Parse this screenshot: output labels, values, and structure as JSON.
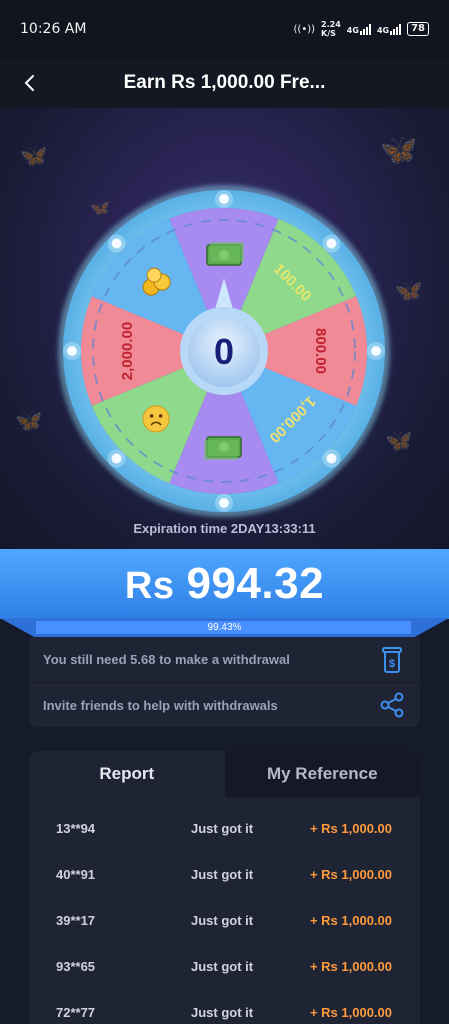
{
  "status": {
    "time": "10:26 AM",
    "net_speed": "2.24",
    "net_unit": "K/S",
    "signal1": "4G",
    "signal2": "4G",
    "battery": "78"
  },
  "header": {
    "back_icon": "chevron-left-icon",
    "title": "Earn Rs 1,000.00 Fre..."
  },
  "wheel": {
    "center_value": "0",
    "segments": [
      {
        "label": "cash-icon",
        "color": "#a78bf0"
      },
      {
        "label": "100.00",
        "color": "#8fd98c"
      },
      {
        "label": "800.00",
        "color": "#f08a97"
      },
      {
        "label": "1,000.00",
        "color": "#66b6f2"
      },
      {
        "label": "cash-icon",
        "color": "#a78bf0"
      },
      {
        "label": "sad-face-icon",
        "color": "#8fd98c"
      },
      {
        "label": "2,000.00",
        "color": "#f08a97"
      },
      {
        "label": "coins-icon",
        "color": "#66b6f2"
      }
    ],
    "expiration": "Expiration time  2DAY13:33:11"
  },
  "balance": {
    "currency": "Rs",
    "amount": "994.32",
    "progress_text": "99.43%",
    "progress": 0.9943
  },
  "info": {
    "withdraw_note": "You still need 5.68 to make a withdrawal",
    "withdraw_icon": "withdraw-icon",
    "invite_note": "Invite friends to help with withdrawals",
    "share_icon": "share-icon"
  },
  "tabs": {
    "report": "Report",
    "reference": "My Reference"
  },
  "report_rows": [
    {
      "user": "13**94",
      "msg": "Just got it",
      "amount": "+ Rs 1,000.00"
    },
    {
      "user": "40**91",
      "msg": "Just got it",
      "amount": "+ Rs 1,000.00"
    },
    {
      "user": "39**17",
      "msg": "Just got it",
      "amount": "+ Rs 1,000.00"
    },
    {
      "user": "93**65",
      "msg": "Just got it",
      "amount": "+ Rs 1,000.00"
    },
    {
      "user": "72**77",
      "msg": "Just got it",
      "amount": "+ Rs 1,000.00"
    }
  ],
  "colors": {
    "accent_blue": "#3d8ff0",
    "amount_orange": "#ff9a3c",
    "wheel_rim": "#5fd3e8"
  }
}
